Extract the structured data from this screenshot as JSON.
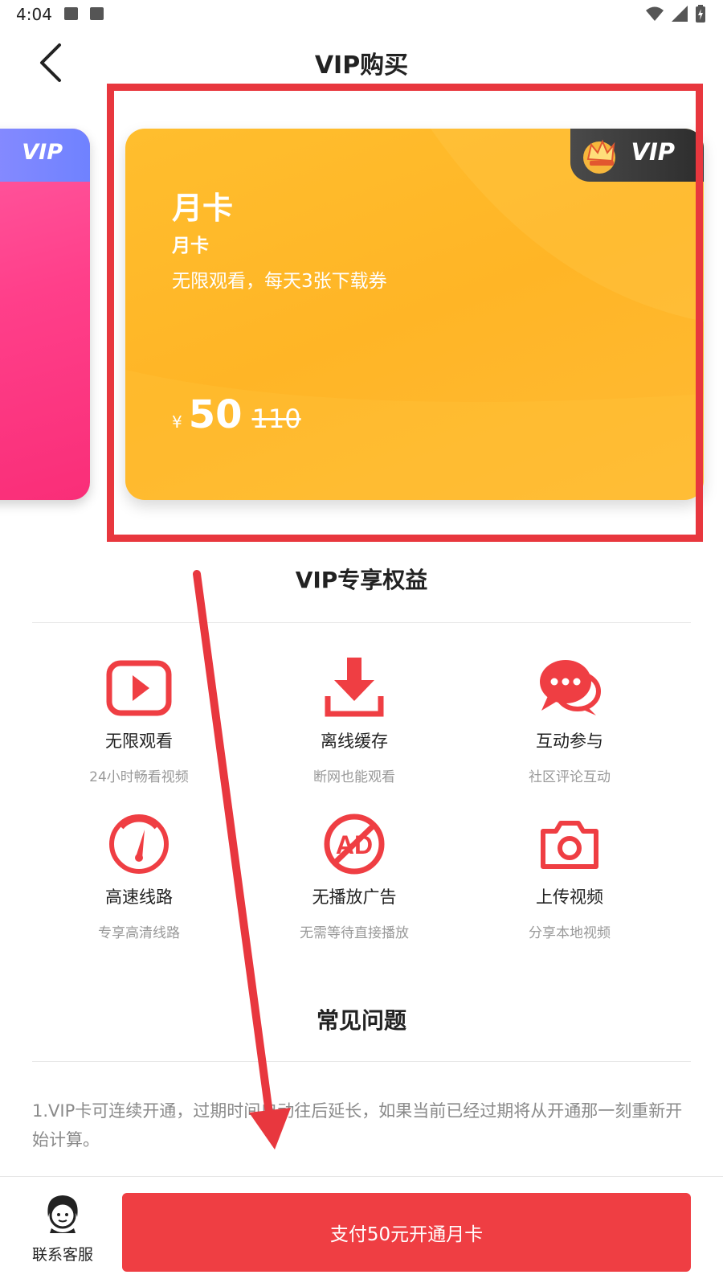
{
  "status_bar": {
    "time": "4:04"
  },
  "header": {
    "title": "VIP购买"
  },
  "carousel": {
    "left_card": {
      "badge": "VIP"
    },
    "main_card": {
      "badge": "VIP",
      "name": "月卡",
      "subtitle": "月卡",
      "description": "无限观看，每天3张下载券",
      "currency": "¥",
      "price": "50",
      "original_price": "110"
    }
  },
  "benefits": {
    "title": "VIP专享权益",
    "items": [
      {
        "title": "无限观看",
        "desc": "24小时畅看视频",
        "icon": "play-icon"
      },
      {
        "title": "离线缓存",
        "desc": "断网也能观看",
        "icon": "download-icon"
      },
      {
        "title": "互动参与",
        "desc": "社区评论互动",
        "icon": "chat-icon"
      },
      {
        "title": "高速线路",
        "desc": "专享高清线路",
        "icon": "speedometer-icon"
      },
      {
        "title": "无播放广告",
        "desc": "无需等待直接播放",
        "icon": "no-ad-icon"
      },
      {
        "title": "上传视频",
        "desc": "分享本地视频",
        "icon": "camera-icon"
      }
    ]
  },
  "faq": {
    "title": "常见问题",
    "items": [
      "1.VIP卡可连续开通，过期时间自动往后延长，如果当前已经过期将从开通那一刻重新开始计算。"
    ]
  },
  "bottom_bar": {
    "service_label": "联系客服",
    "pay_label": "支付50元开通月卡"
  },
  "colors": {
    "accent": "#ef3e43",
    "gold": "#ffb526",
    "pink": "#ff3f8a"
  }
}
